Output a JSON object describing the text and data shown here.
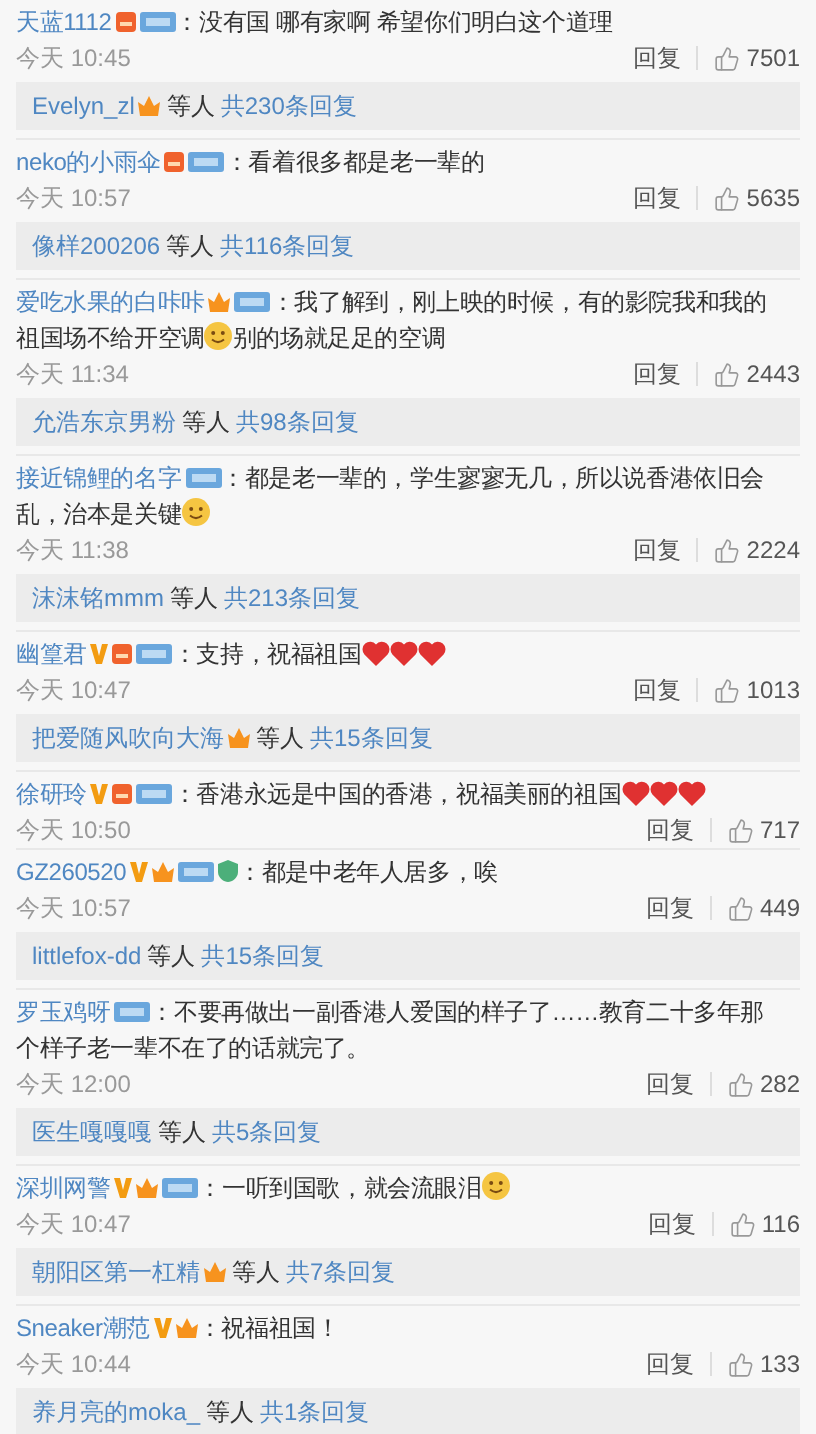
{
  "comments": [
    {
      "name": "天蓝1112",
      "badges": [
        {
          "kind": "fan"
        },
        {
          "kind": "tag"
        }
      ],
      "body": [
        {
          "kind": "text",
          "text": "：没有国 哪有家啊 希望你们明白这个道理"
        }
      ],
      "time": "今天 10:45",
      "reply": "回复",
      "likes": "7501",
      "thread": {
        "name": "Evelyn_zl",
        "badges": [
          {
            "kind": "crown"
          }
        ],
        "etc": "等人",
        "count": "共230条回复"
      }
    },
    {
      "name": "neko的小雨伞",
      "badges": [
        {
          "kind": "fan"
        },
        {
          "kind": "tag"
        }
      ],
      "body": [
        {
          "kind": "text",
          "text": "：看着很多都是老一辈的"
        }
      ],
      "time": "今天 10:57",
      "reply": "回复",
      "likes": "5635",
      "thread": {
        "name": "像样200206",
        "etc": "等人",
        "count": "共116条回复"
      }
    },
    {
      "name": "爱吃水果的白咔咔",
      "badges": [
        {
          "kind": "crown"
        },
        {
          "kind": "tag"
        }
      ],
      "body": [
        {
          "kind": "text",
          "text": "：我了解到，刚上映的时候，有的影院我和我的"
        },
        {
          "kind": "text",
          "text": "祖国场不给开空调"
        },
        {
          "kind": "smiley"
        },
        {
          "kind": "text",
          "text": "别的场就足足的空调"
        }
      ],
      "time": "今天 11:34",
      "reply": "回复",
      "likes": "2443",
      "thread": {
        "name": "允浩东京男粉",
        "etc": "等人",
        "count": "共98条回复"
      }
    },
    {
      "name": "接近锦鲤的名字",
      "badges": [
        {
          "kind": "tag"
        }
      ],
      "body": [
        {
          "kind": "text",
          "text": "：都是老一辈的，学生寥寥无几，所以说香港依旧会"
        },
        {
          "kind": "text",
          "text": "乱，治本是关键"
        },
        {
          "kind": "smiley"
        }
      ],
      "time": "今天 11:38",
      "reply": "回复",
      "likes": "2224",
      "thread": {
        "name": "沫沫铭mmm",
        "etc": "等人",
        "count": "共213条回复"
      }
    },
    {
      "name": "幽篁君",
      "badges": [
        {
          "kind": "v"
        },
        {
          "kind": "fan"
        },
        {
          "kind": "tag"
        }
      ],
      "body": [
        {
          "kind": "text",
          "text": "：支持，祝福祖国"
        },
        {
          "kind": "heart"
        },
        {
          "kind": "heart"
        },
        {
          "kind": "heart"
        }
      ],
      "time": "今天 10:47",
      "reply": "回复",
      "likes": "1013",
      "thread": {
        "name": "把爱随风吹向大海",
        "badges": [
          {
            "kind": "crown"
          }
        ],
        "etc": "等人",
        "count": "共15条回复"
      }
    },
    {
      "name": "徐研玲",
      "badges": [
        {
          "kind": "v"
        },
        {
          "kind": "fan"
        },
        {
          "kind": "tag"
        }
      ],
      "body": [
        {
          "kind": "text",
          "text": "：香港永远是中国的香港，祝福美丽的祖国"
        },
        {
          "kind": "heart"
        },
        {
          "kind": "heart"
        },
        {
          "kind": "heart"
        }
      ],
      "time": "今天 10:50",
      "reply": "回复",
      "likes": "717"
    },
    {
      "name": "GZ260520",
      "badges": [
        {
          "kind": "v"
        },
        {
          "kind": "crown"
        },
        {
          "kind": "tag"
        },
        {
          "kind": "shield"
        }
      ],
      "body": [
        {
          "kind": "text",
          "text": "：都是中老年人居多，唉"
        }
      ],
      "time": "今天 10:57",
      "reply": "回复",
      "likes": "449",
      "thread": {
        "name": "littlefox-dd",
        "etc": "等人",
        "count": "共15条回复"
      }
    },
    {
      "name": "罗玉鸡呀",
      "badges": [
        {
          "kind": "tag"
        }
      ],
      "body": [
        {
          "kind": "text",
          "text": "：不要再做出一副香港人爱国的样子了……教育二十多年那"
        },
        {
          "kind": "text",
          "text": "个样子老一辈不在了的话就完了。"
        }
      ],
      "time": "今天 12:00",
      "reply": "回复",
      "likes": "282",
      "thread": {
        "name": "医生嘎嘎嘎",
        "etc": "等人",
        "count": "共5条回复"
      }
    },
    {
      "name": "深圳网警",
      "badges": [
        {
          "kind": "v"
        },
        {
          "kind": "crown"
        },
        {
          "kind": "tag"
        }
      ],
      "body": [
        {
          "kind": "text",
          "text": "：一听到国歌，就会流眼泪"
        },
        {
          "kind": "smiley"
        }
      ],
      "time": "今天 10:47",
      "reply": "回复",
      "likes": "116",
      "thread": {
        "name": "朝阳区第一杠精",
        "badges": [
          {
            "kind": "crown"
          }
        ],
        "etc": "等人",
        "count": "共7条回复"
      }
    },
    {
      "name": "Sneaker潮范",
      "badges": [
        {
          "kind": "v"
        },
        {
          "kind": "crown"
        }
      ],
      "body": [
        {
          "kind": "text",
          "text": "：祝福祖国！"
        }
      ],
      "time": "今天 10:44",
      "reply": "回复",
      "likes": "133",
      "thread": {
        "name": "养月亮的moka_",
        "etc": "等人",
        "count": "共1条回复"
      }
    }
  ]
}
